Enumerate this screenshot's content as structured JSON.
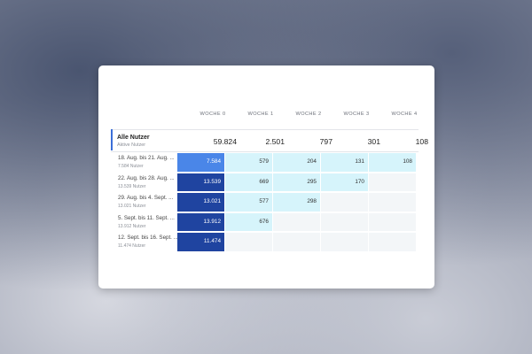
{
  "columns": [
    "WOCHE 0",
    "WOCHE 1",
    "WOCHE 2",
    "WOCHE 3",
    "WOCHE 4"
  ],
  "all_users": {
    "title": "Alle Nutzer",
    "subtitle": "Aktive Nutzer",
    "values": [
      "59.824",
      "2.501",
      "797",
      "301",
      "108"
    ]
  },
  "cohorts": [
    {
      "label": "18. Aug. bis 21. Aug. ...",
      "sub": "7.584 Nutzer",
      "cells": [
        "7.584",
        "579",
        "204",
        "131",
        "108"
      ]
    },
    {
      "label": "22. Aug. bis 28. Aug. ...",
      "sub": "13.539 Nutzer",
      "cells": [
        "13.539",
        "669",
        "295",
        "170",
        ""
      ]
    },
    {
      "label": "29. Aug. bis 4. Sept. ...",
      "sub": "13.021 Nutzer",
      "cells": [
        "13.021",
        "577",
        "298",
        "",
        ""
      ]
    },
    {
      "label": "5. Sept. bis 11. Sept. ...",
      "sub": "13.912 Nutzer",
      "cells": [
        "13.912",
        "676",
        "",
        "",
        ""
      ]
    },
    {
      "label": "12. Sept. bis 16. Sept. ...",
      "sub": "11.474 Nutzer",
      "cells": [
        "11.474",
        "",
        "",
        "",
        ""
      ]
    }
  ],
  "colors": {
    "week0_first": "#4a86e8",
    "week0_dark": "#1f44a0",
    "value_light": "#d6f4fb",
    "empty_cell": "#f3f6f8",
    "accent_marker": "#3b6fd8"
  }
}
